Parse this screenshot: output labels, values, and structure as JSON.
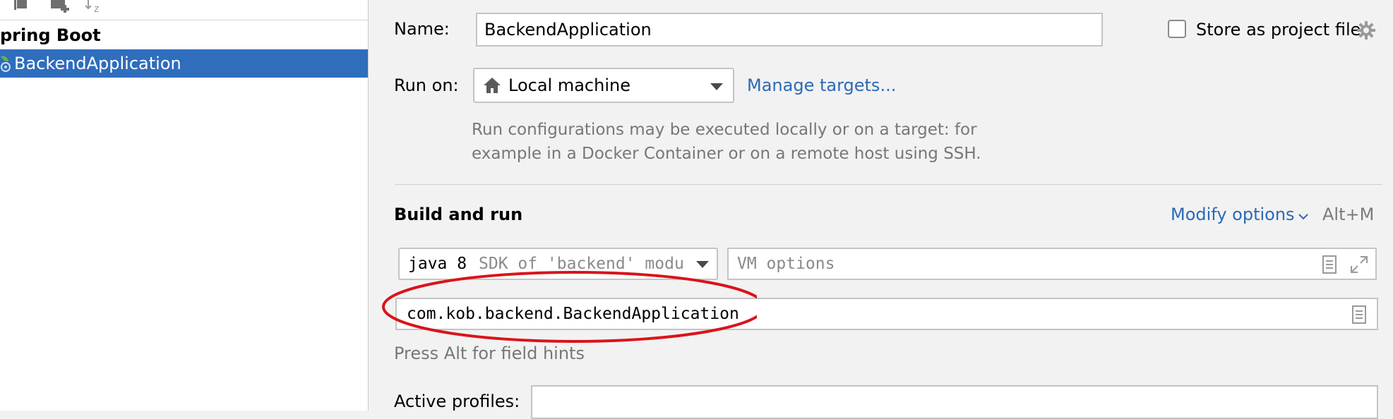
{
  "sidebar": {
    "group_label": "pring Boot",
    "selected_item": "BackendApplication"
  },
  "form": {
    "name_label": "Name:",
    "name_value": "BackendApplication",
    "store_label": "Store as project file",
    "run_on_label": "Run on:",
    "run_on_value": "Local machine",
    "manage_targets": "Manage targets...",
    "run_hint_line1": "Run configurations may be executed locally or on a target: for",
    "run_hint_line2": "example in a Docker Container or on a remote host using SSH.",
    "build_run_title": "Build and run",
    "modify_options": "Modify options",
    "modify_shortcut": "Alt+M",
    "sdk_name": "java 8",
    "sdk_detail": "SDK of 'backend' modu",
    "vm_placeholder": "VM options",
    "main_class": "com.kob.backend.BackendApplication",
    "field_hints": "Press Alt for field hints",
    "active_profiles_label": "Active profiles:"
  },
  "colors": {
    "selection": "#2f6dbd",
    "link": "#2b6ab6",
    "annotation": "#d9141b"
  }
}
